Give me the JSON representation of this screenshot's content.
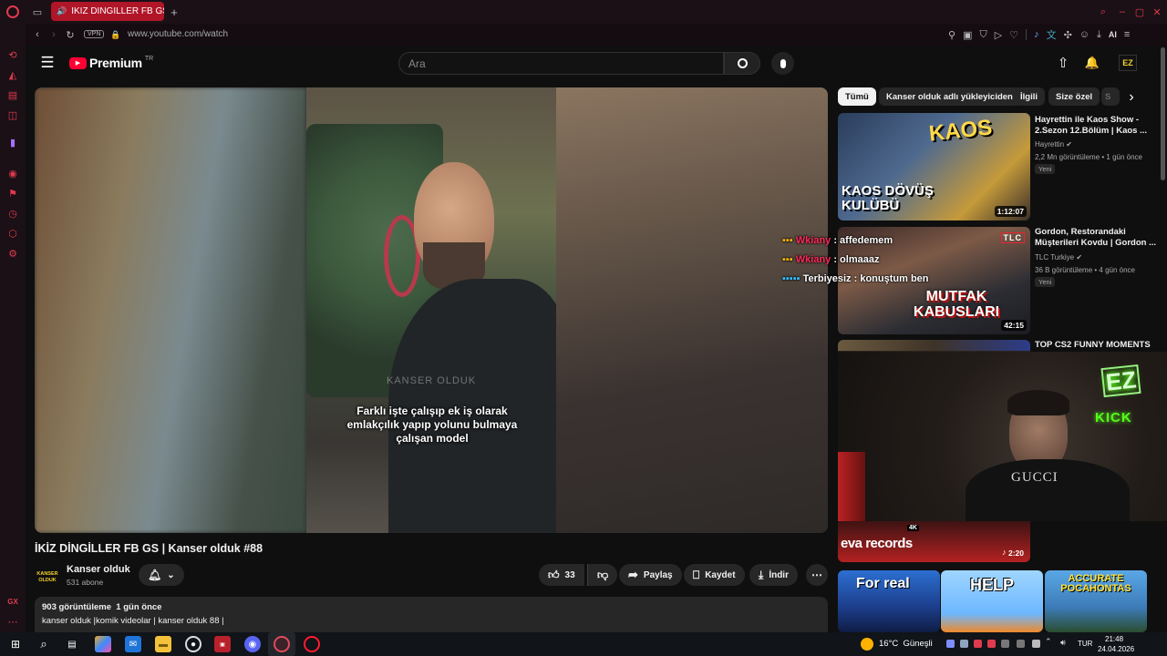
{
  "browser": {
    "tab_title": "İKİZ DİNGİLLER FB GS",
    "new_tab": "+",
    "vpn": "VPN",
    "url": "www.youtube.com/watch",
    "ai_label": "AI"
  },
  "header": {
    "logo_text": "Premium",
    "logo_superscript": "TR",
    "search_placeholder": "Ara"
  },
  "chips": [
    "Tümü",
    "Kanser olduk adlı yükleyiciden",
    "İlgili",
    "Size özel",
    "S"
  ],
  "video": {
    "caption": "Farklı işte çalışıp ek iş olarak emlakçılık yapıp yolunu bulmaya çalışan model",
    "watermark": "KANSER OLDUK",
    "title": "İKİZ DİNGİLLER FB GS | Kanser olduk #88",
    "channel_name": "Kanser olduk",
    "subscribers": "531 abone",
    "channel_logo": "KANSER OLDUK",
    "like_count": "33",
    "share_label": "Paylaş",
    "save_label": "Kaydet",
    "download_label": "İndir",
    "description_stats": "903 görüntüleme  1 gün önce",
    "description_text": "kanser olduk |komik videolar | kanser olduk 88  |"
  },
  "recommendations": [
    {
      "title": "Hayrettin ile Kaos Show - 2.Sezon 12.Bölüm | Kaos ...",
      "channel": "Hayrettin",
      "meta": "2,2 Mn görüntüleme • 1 gün önce",
      "badge": "Yeni",
      "duration": "1:12:07",
      "thumb_text": "KAOS DÖVÜŞ KULÜBÜ",
      "thumb_logo": "KAOS"
    },
    {
      "title": "Gordon, Restorandaki Müşterileri Kovdu | Gordon ...",
      "channel": "TLC Turkiye",
      "meta": "36 B görüntüleme • 4 gün önce",
      "badge": "Yeni",
      "duration": "42:15",
      "thumb_text": "MUTFAK KABUSLARI",
      "thumb_logo": "TLC"
    },
    {
      "title": "TOP CS2 FUNNY MOMENTS",
      "duration": "2:20",
      "thumb_text": "eva records",
      "thumb_badge": "4K"
    }
  ],
  "shorts": [
    "For real",
    "HELP",
    "ACCURATE POCAHONTAS"
  ],
  "overlay": {
    "chat": [
      {
        "user": "Wkiany",
        "text": " : affedemem"
      },
      {
        "user": "Wkiany",
        "text": " : olmaaaz"
      },
      {
        "user": "Terbiyesiz",
        "text": " : konuştum ben"
      }
    ],
    "webcam_logo": "EZ",
    "webcam_kick": "KICK",
    "shirt_text": "GUCCI"
  },
  "taskbar": {
    "weather": "16°C  Güneşli",
    "lang": "TUR",
    "time": "21:48",
    "date": "24.04.2026"
  },
  "colors": {
    "accent_red": "#ff0033",
    "opera_red": "#e03a4e",
    "kick_green": "#53fc18"
  }
}
